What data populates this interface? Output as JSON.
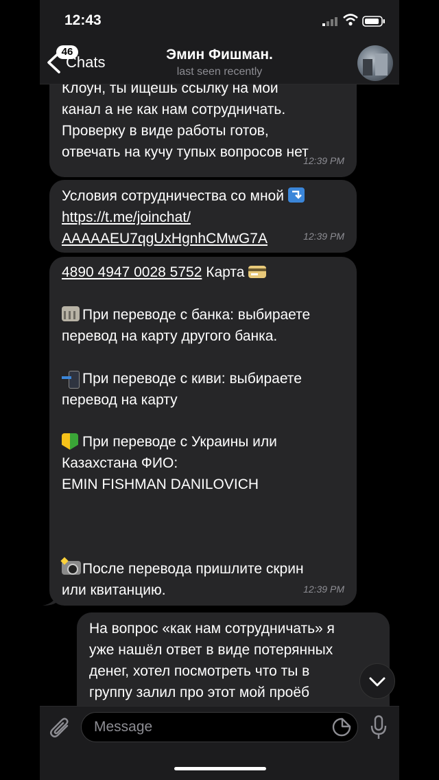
{
  "status": {
    "time": "12:43"
  },
  "header": {
    "back_label": "Chats",
    "unread_count": "46",
    "contact_name": "Эмин Фишман.",
    "last_seen": "last seen recently"
  },
  "messages": [
    {
      "type": "incoming",
      "text": "Клоун, ты ищешь ссылку на мой\nканал а не как нам сотрудничать.\nПроверку в виде работы готов,\nотвечать на кучу тупых вопросов нет",
      "time": "12:39 PM"
    },
    {
      "type": "incoming",
      "text": "Условия  сотрудничества со мной",
      "link_line1": "https://t.me/joinchat/",
      "link_line2": "AAAAAEU7qgUxHgnhCMwG7A",
      "time": "12:39 PM"
    },
    {
      "type": "incoming",
      "card_number": "4890 4947 0028 5752",
      "card_label": "Карта",
      "bank_text": "При переводе с банка: выбираете\nперевод на карту другого банка.",
      "qiwi_text": "При переводе с киви: выбираете\nперевод на карту",
      "ukraine_text": "При переводе с Украины или\nКазахстана ФИО:",
      "fio": "EMIN FISHMAN DANILOVICH",
      "after_text": "После перевода пришлите скрин\nили квитанцию.",
      "time": "12:39 PM"
    },
    {
      "type": "outgoing",
      "text": "На вопрос «как нам сотрудничать» я\nуже нашёл ответ в виде потерянных\nденег, хотел посмотреть что ты в\nгруппу залил про этот мой проёб"
    }
  ],
  "input": {
    "placeholder": "Message"
  },
  "icons": {
    "back": "chevron-left-icon",
    "attach": "paperclip-icon",
    "sticker": "sticker-icon",
    "mic": "microphone-icon",
    "scroll": "chevron-down-icon"
  }
}
